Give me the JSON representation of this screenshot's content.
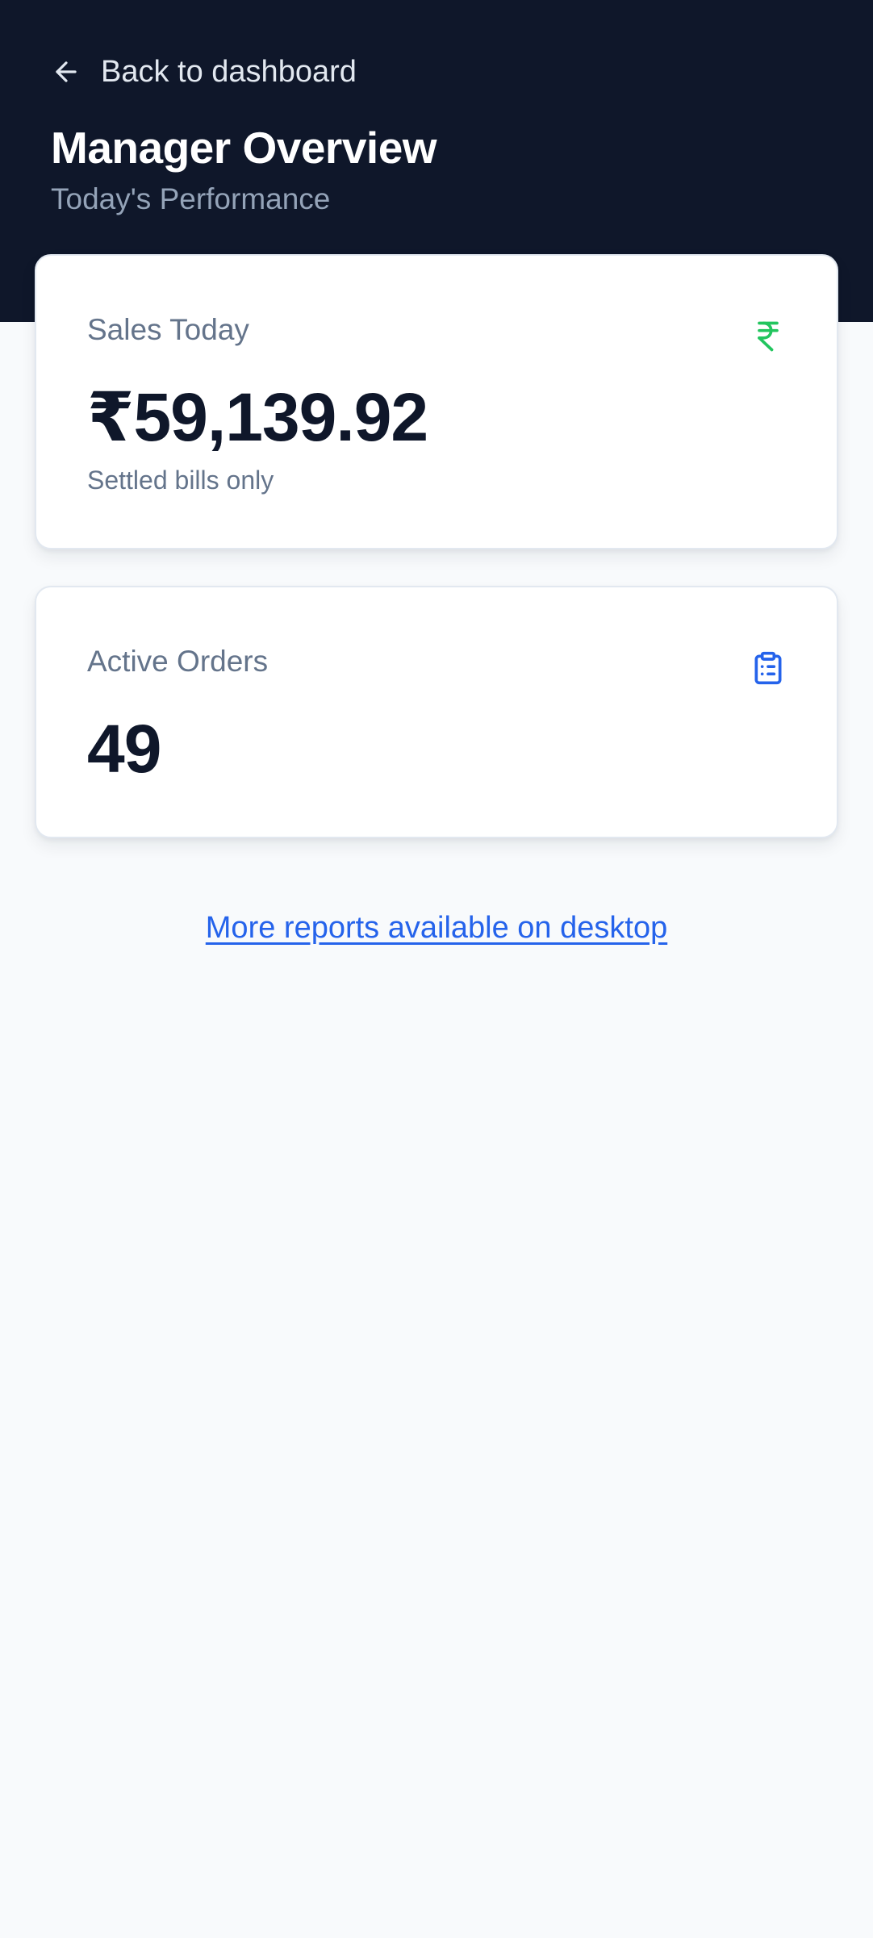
{
  "header": {
    "back_label": "Back to dashboard",
    "back_icon": "arrow-left-icon",
    "title": "Manager Overview",
    "subtitle": "Today's Performance",
    "background_color": "#0f172a"
  },
  "cards": [
    {
      "label": "Sales Today",
      "value": "₹59,139.92",
      "note": "Settled bills only",
      "icon": "rupee-icon",
      "icon_color": "#22c55e"
    },
    {
      "label": "Active Orders",
      "value": "49",
      "icon": "clipboard-list-icon",
      "icon_color": "#2563eb"
    }
  ],
  "footer": {
    "link_label": "More reports available on desktop",
    "link_color": "#2563eb"
  }
}
